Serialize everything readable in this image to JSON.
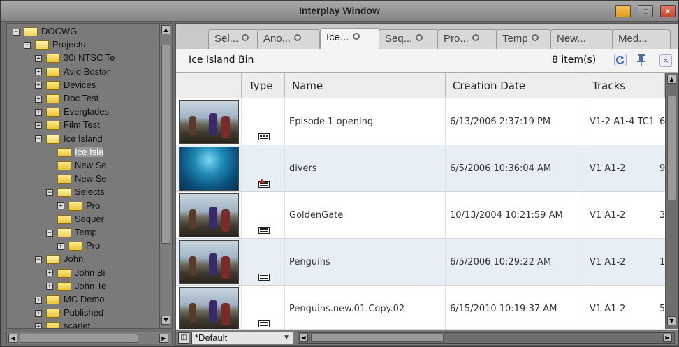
{
  "window": {
    "title": "Interplay Window",
    "min_label": "_",
    "max_label": "□",
    "close_label": "×"
  },
  "tree": {
    "items": [
      {
        "label": "DOCWG",
        "expander": "−",
        "open": true
      },
      {
        "label": "Projects",
        "expander": "−",
        "open": true
      },
      {
        "label": "30i NTSC Te",
        "expander": "+"
      },
      {
        "label": "Avid Bostor",
        "expander": "+"
      },
      {
        "label": "Devices",
        "expander": "+"
      },
      {
        "label": "Doc Test",
        "expander": "+"
      },
      {
        "label": "Everglades",
        "expander": "+"
      },
      {
        "label": "Film Test",
        "expander": "+"
      },
      {
        "label": "Ice Island",
        "expander": "−",
        "open": true
      },
      {
        "label": "Ice Isla",
        "expander": ""
      },
      {
        "label": "New Se",
        "expander": ""
      },
      {
        "label": "New Se",
        "expander": ""
      },
      {
        "label": "Selects",
        "expander": "−",
        "open": true
      },
      {
        "label": "Pro",
        "expander": "+"
      },
      {
        "label": "Sequer",
        "expander": ""
      },
      {
        "label": "Temp",
        "expander": "−",
        "open": true
      },
      {
        "label": "Pro",
        "expander": "+"
      },
      {
        "label": "John",
        "expander": "−",
        "open": true
      },
      {
        "label": "John Bi",
        "expander": "+"
      },
      {
        "label": "John Te",
        "expander": "+"
      },
      {
        "label": "MC Demo",
        "expander": "+"
      },
      {
        "label": "Published",
        "expander": "+"
      },
      {
        "label": "scarlet",
        "expander": "+"
      }
    ]
  },
  "tabs": [
    {
      "label": "Sel..."
    },
    {
      "label": "Ano..."
    },
    {
      "label": "Ice..."
    },
    {
      "label": "Seq..."
    },
    {
      "label": "Pro..."
    },
    {
      "label": "Temp"
    },
    {
      "label": "New..."
    },
    {
      "label": "Med..."
    }
  ],
  "bin": {
    "title": "Ice Island Bin",
    "count": "8 item(s)",
    "refresh_icon": "refresh-icon",
    "pin_icon": "pin-icon",
    "close_label": "×"
  },
  "table": {
    "headers": [
      "Type",
      "Name",
      "Creation Date",
      "Tracks"
    ],
    "rows": [
      {
        "thumb": "penguins",
        "name": "Episode 1 opening",
        "date": "6/13/2006 2:37:19 PM",
        "tracks": "V1-2 A1-4 TC1",
        "extra": "6"
      },
      {
        "thumb": "divers",
        "name": "divers",
        "date": "6/5/2006 10:36:04 AM",
        "tracks": "V1 A1-2",
        "extra": "9"
      },
      {
        "thumb": "penguins",
        "name": "GoldenGate",
        "date": "10/13/2004 10:21:59 AM",
        "tracks": "V1 A1-2",
        "extra": "3"
      },
      {
        "thumb": "penguins",
        "name": "Penguins",
        "date": "6/5/2006 10:29:22 AM",
        "tracks": "V1 A1-2",
        "extra": "1"
      },
      {
        "thumb": "penguins",
        "name": "Penguins.new.01.Copy.02",
        "date": "6/15/2010 10:19:37 AM",
        "tracks": "V1 A1-2",
        "extra": "5"
      }
    ]
  },
  "footer": {
    "view_preset": "*Default"
  }
}
